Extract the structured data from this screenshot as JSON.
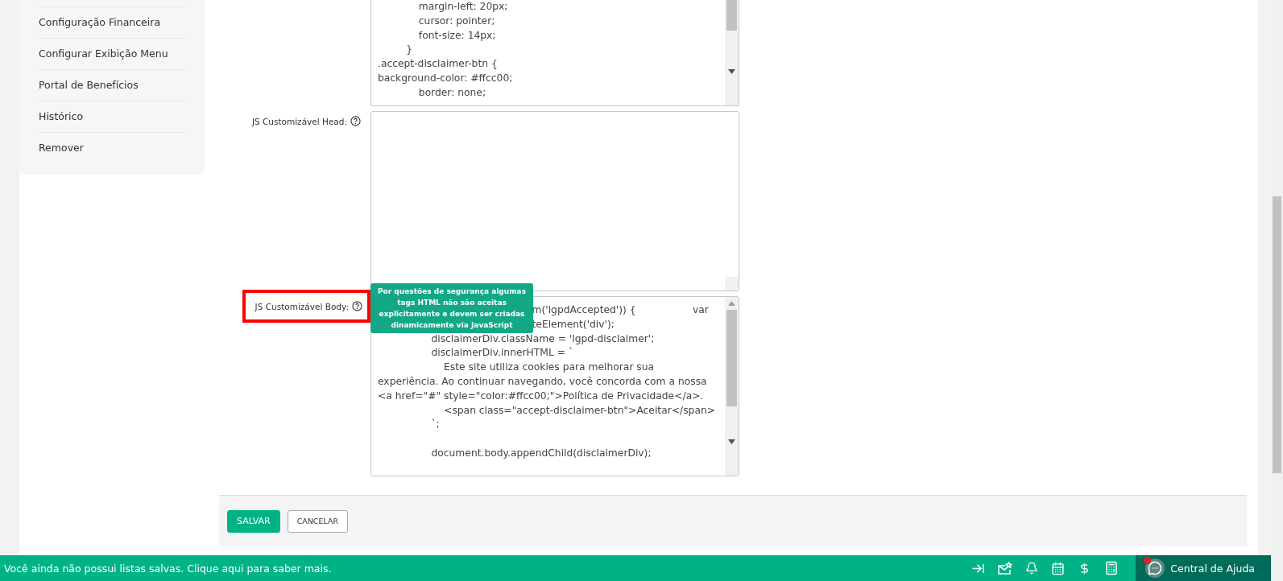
{
  "sidebar": {
    "items": [
      {
        "label": "Configuração Financeira"
      },
      {
        "label": "Configurar Exibição Menu"
      },
      {
        "label": "Portal de Benefícios"
      },
      {
        "label": "Histórico"
      },
      {
        "label": "Remover"
      }
    ]
  },
  "form": {
    "fields": [
      {
        "highlighted": false,
        "scrollbar": true,
        "value": "             margin-left: 20px;\n             cursor: pointer;\n             font-size: 14px;\n         }\n.accept-disclaimer-btn {\nbackground-color: #ffcc00;\n             border: none;"
      },
      {
        "label": "JS Customizável Head:",
        "highlighted": false,
        "scrollbar": false
      },
      {
        "label": "JS Customizável Body:",
        "highlighted": true,
        "scrollbar": true,
        "tooltip": "Por questões de segurança algumas tags HTML não são aceitas explicitamente e devem ser criadas dinamicamente via JavaScript",
        "value": "                                                 m('lgpdAccepted')) {                  var\n                                                 teElement('div');\n                 disclaimerDiv.className = 'lgpd-disclaimer';\n                 disclaimerDiv.innerHTML = `\n                     Este site utiliza cookies para melhorar sua\nexperiência. Ao continuar navegando, você concorda com a nossa\n<a href=\"#\" style=\"color:#ffcc00;\">Política de Privacidade</a>.\n                     <span class=\"accept-disclaimer-btn\">Aceitar</span>\n                 `;\n\n                 document.body.appendChild(disclaimerDiv);"
      }
    ],
    "buttons": [
      {
        "label": "SALVAR",
        "kind": "primary"
      },
      {
        "label": "CANCELAR",
        "kind": "secondary"
      }
    ]
  },
  "status_bar": {
    "message": "Você ainda não possui listas salvas. Clique aqui para saber mais.",
    "help": {
      "label": "Central de Ajuda",
      "notification": true
    }
  }
}
